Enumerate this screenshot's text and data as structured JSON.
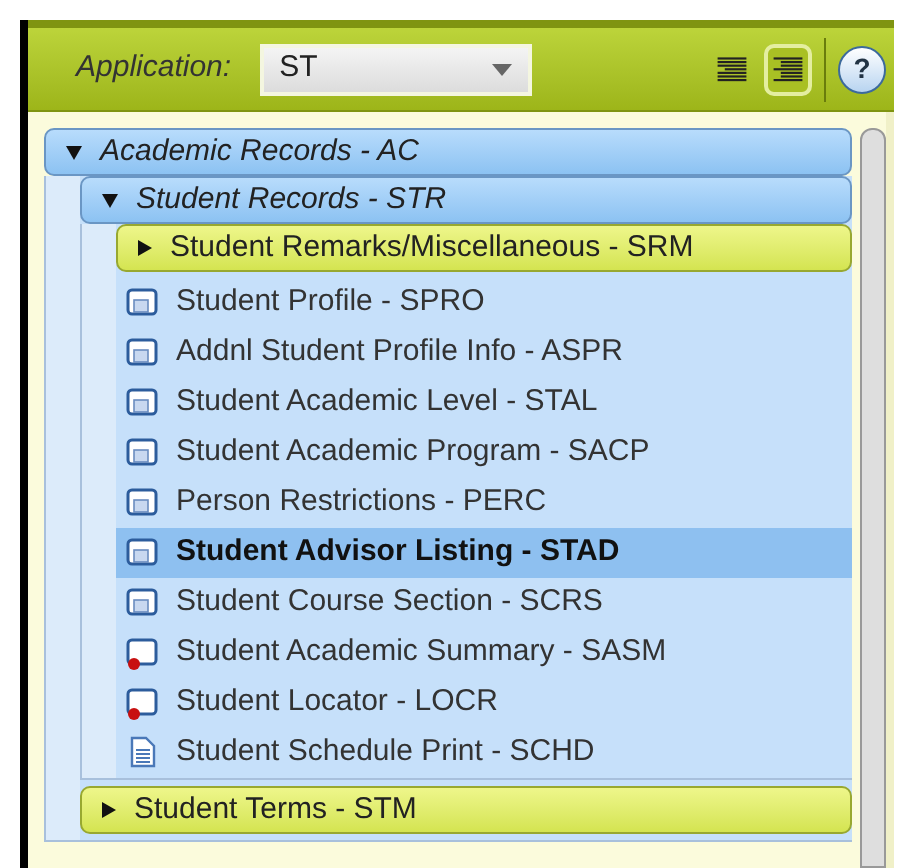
{
  "application": {
    "label": "Application:",
    "value": "ST"
  },
  "view_buttons": [
    {
      "selected": false
    },
    {
      "selected": true
    }
  ],
  "help": "?",
  "tree": [
    {
      "label": "Academic Records - AC",
      "kind": "folder",
      "expanded": true,
      "children": [
        {
          "label": "Student Records - STR",
          "kind": "folder",
          "expanded": true,
          "children": [
            {
              "label": "Student Remarks/Miscellaneous - SRM",
              "kind": "folder",
              "expanded": false
            },
            {
              "label": "Student Profile - SPRO",
              "kind": "form",
              "selected": false
            },
            {
              "label": "Addnl Student Profile Info - ASPR",
              "kind": "form",
              "selected": false
            },
            {
              "label": "Student Academic Level - STAL",
              "kind": "form",
              "selected": false
            },
            {
              "label": "Student Academic Program - SACP",
              "kind": "form",
              "selected": false
            },
            {
              "label": "Person Restrictions - PERC",
              "kind": "form",
              "selected": false
            },
            {
              "label": "Student Advisor Listing - STAD",
              "kind": "form",
              "selected": true
            },
            {
              "label": "Student Course Section - SCRS",
              "kind": "form",
              "selected": false
            },
            {
              "label": "Student Academic Summary - SASM",
              "kind": "form-alert",
              "selected": false
            },
            {
              "label": "Student Locator - LOCR",
              "kind": "form-alert",
              "selected": false
            },
            {
              "label": "Student Schedule Print - SCHD",
              "kind": "document",
              "selected": false
            }
          ]
        },
        {
          "label": "Student Terms - STM",
          "kind": "folder",
          "expanded": false
        }
      ]
    }
  ]
}
